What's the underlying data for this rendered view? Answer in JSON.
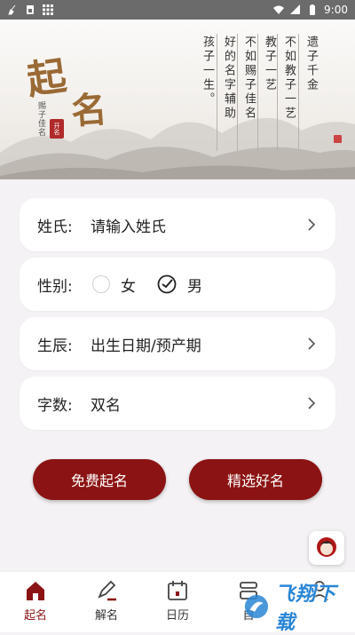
{
  "status_bar": {
    "time": "9:00"
  },
  "header": {
    "title_char_1": "起",
    "title_char_2": "名",
    "subtitle": "赐子佳名",
    "seal_text": "开名",
    "poem": [
      "遗子千金",
      "不如教子一艺",
      "教子一艺",
      "不如赐子佳名",
      "好的名字辅助",
      "孩子一生。"
    ]
  },
  "form": {
    "surname": {
      "label": "姓氏:",
      "placeholder": "请输入姓氏"
    },
    "gender": {
      "label": "性别:",
      "female": "女",
      "male": "男",
      "selected": "男"
    },
    "birth": {
      "label": "生辰:",
      "placeholder": "出生日期/预产期"
    },
    "word_count": {
      "label": "字数:",
      "value": "双名"
    }
  },
  "buttons": {
    "free": "免费起名",
    "select": "精选好名"
  },
  "tabs": [
    {
      "label": "起名",
      "icon": "home-icon",
      "active": true
    },
    {
      "label": "解名",
      "icon": "pen-icon",
      "active": false
    },
    {
      "label": "日历",
      "icon": "calendar-icon",
      "active": false
    },
    {
      "label": "自",
      "icon": "book-icon",
      "active": false
    },
    {
      "label": "",
      "icon": "user-icon",
      "active": false
    }
  ],
  "watermark": {
    "text": "飞翔下载"
  },
  "colors": {
    "accent": "#8b1313",
    "gold": "#9a6a35",
    "background": "#f4f2f4"
  }
}
